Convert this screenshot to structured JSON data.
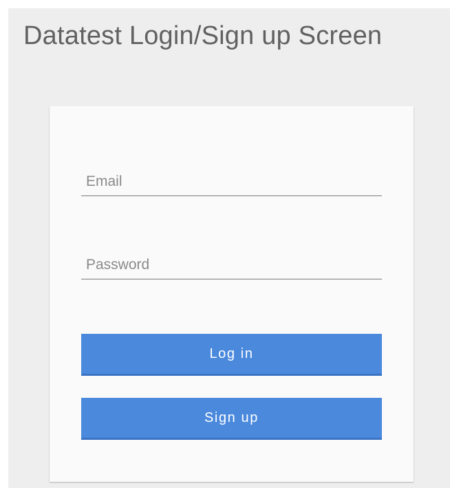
{
  "page": {
    "title": "Datatest Login/Sign up Screen"
  },
  "form": {
    "email": {
      "placeholder": "Email",
      "value": ""
    },
    "password": {
      "placeholder": "Password",
      "value": ""
    },
    "login_label": "Log in",
    "signup_label": "Sign up"
  },
  "colors": {
    "background": "#eeeeee",
    "card": "#fafafa",
    "button": "#4a89dc",
    "button_border": "#3b73c4",
    "title_text": "#616161"
  }
}
